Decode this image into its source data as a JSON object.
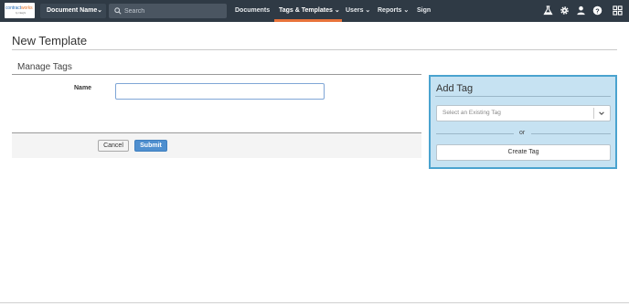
{
  "colors": {
    "navbar_bg": "#2f3a45",
    "active_underline": "#e8733a",
    "submit_bg": "#4f8fcf",
    "panel_bg": "#c6e2f2",
    "panel_border": "#4aa3cf"
  },
  "navbar": {
    "logo": {
      "text_main": "contract",
      "text_accent": "works",
      "text_sub": "by InEight",
      "icon": "contractworks-logo"
    },
    "doc_name": {
      "label": "Document Name",
      "icon": "chevron-down-icon"
    },
    "search": {
      "placeholder": "Search",
      "icon": "search-icon"
    },
    "items": [
      {
        "label": "Documents"
      },
      {
        "label": "Tags & Templates"
      },
      {
        "label": "Users"
      },
      {
        "label": "Reports"
      },
      {
        "label": "Sign"
      }
    ],
    "active_item": "Tags & Templates",
    "right_icons": [
      "flask-icon",
      "gear-icon",
      "user-icon",
      "help-icon",
      "apps-grid-icon"
    ]
  },
  "page": {
    "title": "New Template",
    "section_title": "Manage Tags",
    "form": {
      "name_label": "Name",
      "name_value": ""
    },
    "buttons": {
      "cancel": "Cancel",
      "submit": "Submit"
    }
  },
  "add_tag": {
    "title": "Add Tag",
    "select_placeholder": "Select an Existing Tag",
    "or_text": "or",
    "create_label": "Create Tag"
  }
}
